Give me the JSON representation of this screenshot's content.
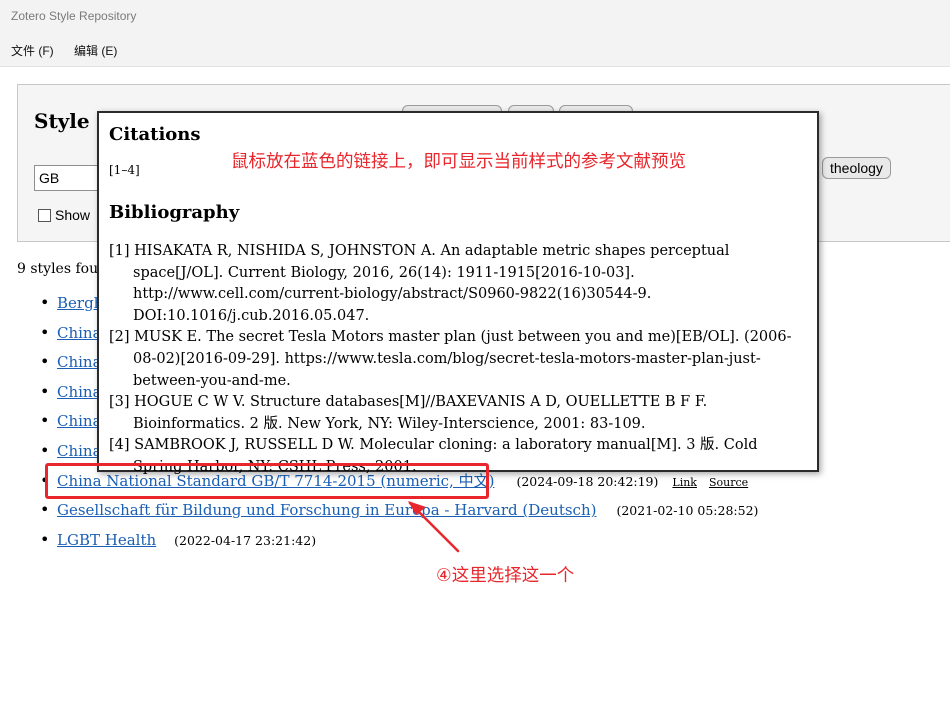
{
  "window": {
    "title": "Zotero Style Repository"
  },
  "menu": [
    {
      "label": "文件 (F)"
    },
    {
      "label": "编辑 (E)"
    }
  ],
  "search": {
    "heading": "Style S",
    "query": "GB",
    "show_label": "Show",
    "tag_button": "theology"
  },
  "results": {
    "count_text": "9 styles fou",
    "items": [
      {
        "title": "Bergh"
      },
      {
        "title": "China"
      },
      {
        "title": "China"
      },
      {
        "title": "China"
      },
      {
        "title": "China"
      },
      {
        "title": "China"
      },
      {
        "title": "China National Standard GB/T 7714-2015 (numeric, 中文)",
        "date": "(2024-09-18 20:42:19)",
        "link": "Link",
        "source": "Source"
      },
      {
        "title": "Gesellschaft für Bildung und Forschung in Europa - Harvard (Deutsch)",
        "date": "(2021-02-10 05:28:52)"
      },
      {
        "title": "LGBT Health",
        "date": "(2022-04-17 23:21:42)"
      }
    ]
  },
  "preview": {
    "citations_heading": "Citations",
    "citation_text": "[1–4]",
    "bibliography_heading": "Bibliography",
    "entries": [
      "[1] HISAKATA R, NISHIDA S, JOHNSTON A. An adaptable metric shapes perceptual space[J/OL]. Current Biology, 2016, 26(14): 1911-1915[2016-10-03]. http://www.cell.com/current-biology/abstract/S0960-9822(16)30544-9. DOI:10.1016/j.cub.2016.05.047.",
      "[2] MUSK E. The secret Tesla Motors master plan (just between you and me)[EB/OL]. (2006-08-02)[2016-09-29]. https://www.tesla.com/blog/secret-tesla-motors-master-plan-just-between-you-and-me.",
      "[3] HOGUE C W V. Structure databases[M]//BAXEVANIS A D, OUELLETTE B F F. Bioinformatics. 2 版. New York, NY: Wiley-Interscience, 2001: 83-109.",
      "[4] SAMBROOK J, RUSSELL D W. Molecular cloning: a laboratory manual[M]. 3 版. Cold Spring Harbor, NY: CSHL Press, 2001."
    ]
  },
  "annotations": {
    "hover_tip": "鼠标放在蓝色的链接上，即可显示当前样式的参考文献预览",
    "select_tip": "④这里选择这一个",
    "color": "#e8262c"
  }
}
